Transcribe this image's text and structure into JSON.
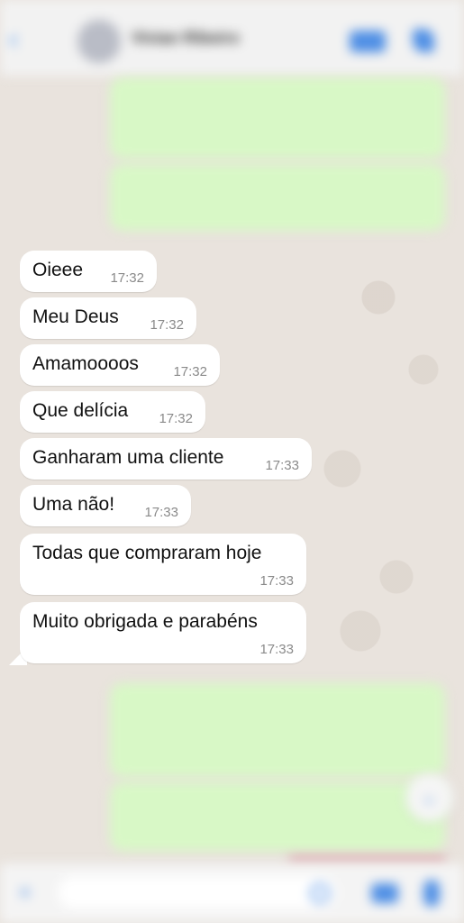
{
  "header": {
    "contact_name": "Vivian Ribeiro",
    "back_icon": "chevron-left-icon",
    "video_icon": "video-camera-icon",
    "phone_icon": "phone-icon"
  },
  "messages": [
    {
      "text": "Oieee",
      "time": "17:32"
    },
    {
      "text": "Meu Deus",
      "time": "17:32"
    },
    {
      "text": "Amamoooos",
      "time": "17:32"
    },
    {
      "text": "Que delícia",
      "time": "17:32"
    },
    {
      "text": "Ganharam uma cliente",
      "time": "17:33"
    },
    {
      "text": "Uma não!",
      "time": "17:33"
    },
    {
      "text": "Todas que compraram hoje",
      "time": "17:33"
    },
    {
      "text": "Muito obrigada e parabéns",
      "time": "17:33"
    }
  ],
  "colors": {
    "outgoing_bubble": "#d8f8c6",
    "incoming_bubble": "#ffffff",
    "accent": "#4f8fe5",
    "chat_background": "#e9e3dd"
  },
  "input_bar": {
    "plus_icon": "plus-icon",
    "sticker_icon": "sticker-icon",
    "camera_icon": "camera-icon",
    "mic_icon": "microphone-icon"
  }
}
